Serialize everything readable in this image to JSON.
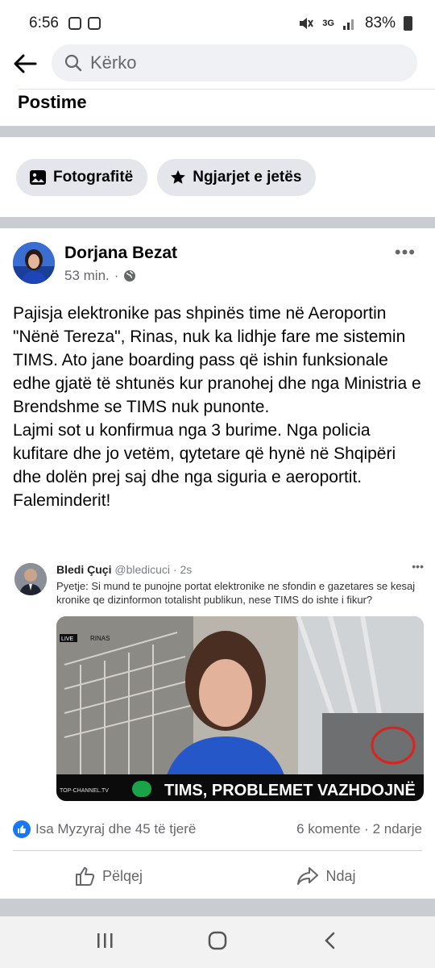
{
  "status_bar": {
    "time": "6:56",
    "network": "3G",
    "battery": "83%"
  },
  "search": {
    "placeholder": "Kërko"
  },
  "section": {
    "title": "Postime"
  },
  "filters": [
    {
      "label": "Fotografitë",
      "icon": "photos-icon"
    },
    {
      "label": "Ngjarjet e jetës",
      "icon": "star-icon"
    }
  ],
  "post": {
    "author": "Dorjana Bezat",
    "time": "53 min.",
    "separator": "·",
    "privacy_icon": "globe-icon",
    "text": "Pajisja elektronike pas shpinës time në Aeroportin \"Nënë Tereza\", Rinas, nuk ka lidhje fare me sistemin TIMS. Ato jane boarding pass që ishin funksionale edhe gjatë të shtunës kur pranohej dhe nga Ministria e Brendshme se TIMS nuk punonte.\nLajmi sot u konfirmua nga 3 burime. Nga policia kufitare dhe jo vetëm, qytetare që hynë në Shqipëri dhe dolën prej saj dhe nga siguria e aeroportit. Faleminderit!",
    "embed": {
      "name": "Bledi Çuçi",
      "handle": "@bledicuci · 2s",
      "text": "Pyetje: Si mund te punojne portat elektronike ne sfondin e gazetares se kesaj kronike qe dizinformon totalisht publikun, nese TIMS do ishte i fikur?",
      "media": {
        "live_badge": "LIVE",
        "location": "RINAS",
        "channel": "TOP-CHANNEL.TV",
        "headline": "TIMS, PROBLEMET VAZHDOJNË"
      }
    },
    "reactions": {
      "text": "Isa Myzyraj dhe 45 të tjerë",
      "counts": "6 komente · 2 ndarje"
    },
    "actions": {
      "like": "Pëlqej",
      "share": "Ndaj"
    }
  },
  "colors": {
    "accent": "#1877f2",
    "band": "#c9ccd1",
    "chip": "#e4e6eb"
  }
}
